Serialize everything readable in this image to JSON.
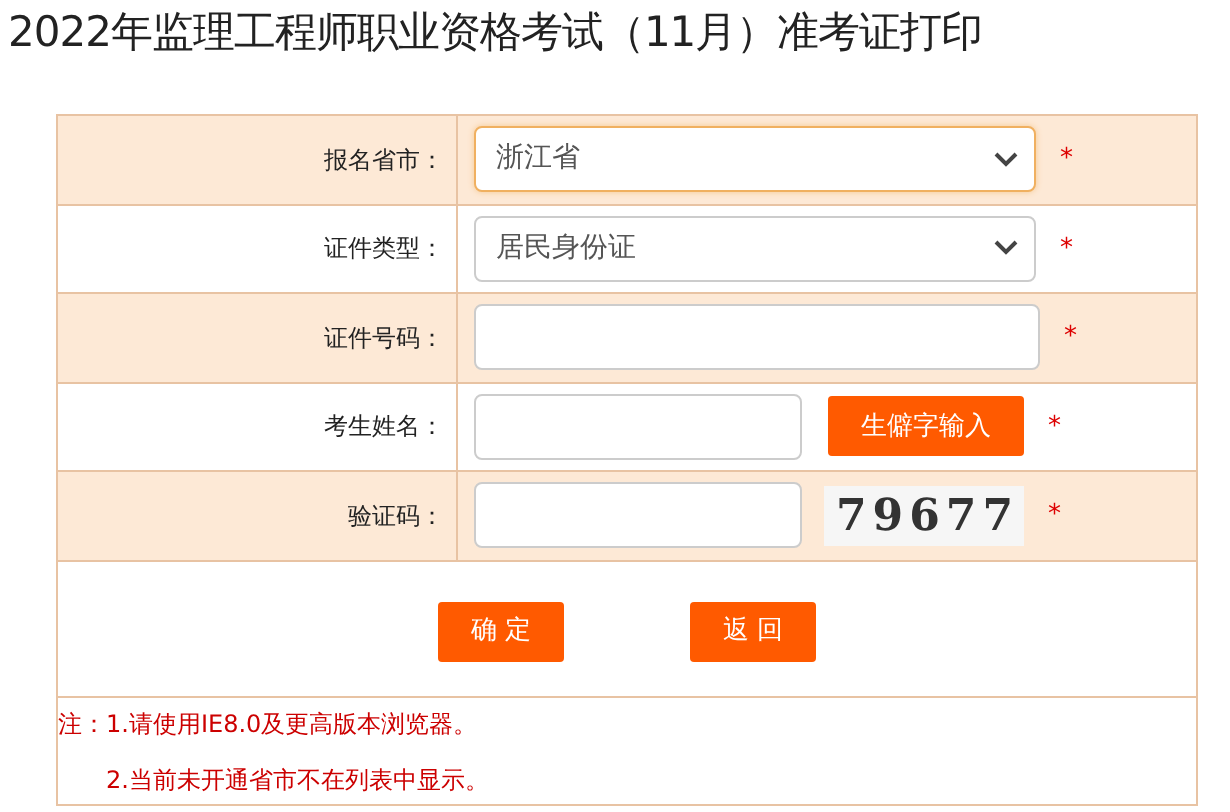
{
  "title": "2022年监理工程师职业资格考试（11月）准考证打印",
  "rows": [
    {
      "kind": "select",
      "label": "报名省市：",
      "value": "浙江省",
      "focused": true,
      "required": "*"
    },
    {
      "kind": "select",
      "label": "证件类型：",
      "value": "居民身份证",
      "focused": false,
      "required": "*"
    },
    {
      "kind": "input",
      "label": "证件号码：",
      "required": "*"
    },
    {
      "kind": "input-button",
      "label": "考生姓名：",
      "button": "生僻字输入",
      "required": "*"
    },
    {
      "kind": "captcha",
      "label": "验证码：",
      "captcha": "79677",
      "required": "*"
    }
  ],
  "buttons": [
    "确 定",
    "返 回"
  ],
  "notes": [
    "注：1.请使用IE8.0及更高版本浏览器。",
    "2.当前未开通省市不在列表中显示。"
  ]
}
